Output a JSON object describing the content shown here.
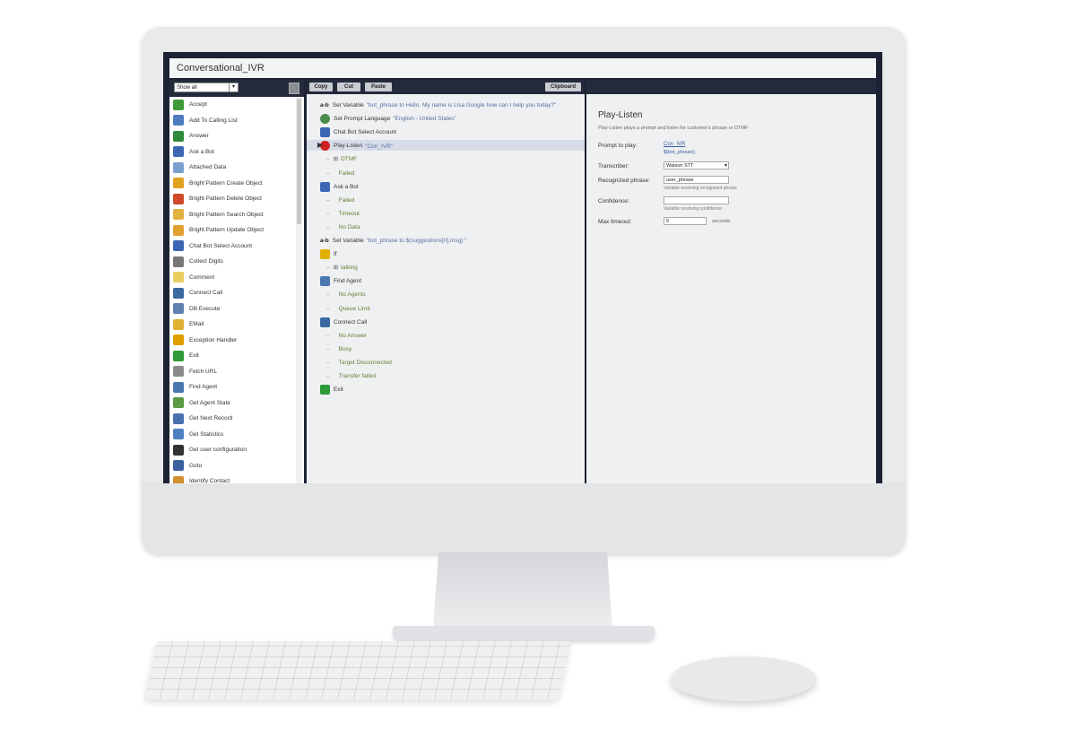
{
  "window": {
    "title": "Conversational_IVR"
  },
  "palette": {
    "filter_value": "Show all",
    "items": [
      {
        "label": "Accept",
        "icon": "accept-icon",
        "color": "#3f9a3a"
      },
      {
        "label": "Add To Calling List",
        "icon": "calling-list-icon",
        "color": "#4d7cc0"
      },
      {
        "label": "Answer",
        "icon": "answer-icon",
        "color": "#2f8a3a"
      },
      {
        "label": "Ask a Bot",
        "icon": "bot-icon",
        "color": "#3d67b5"
      },
      {
        "label": "Attached Data",
        "icon": "attached-data-icon",
        "color": "#7aa0d0"
      },
      {
        "label": "Bright Pattern Create Object",
        "icon": "create-object-icon",
        "color": "#e0a020"
      },
      {
        "label": "Bright Pattern Delete Object",
        "icon": "delete-object-icon",
        "color": "#d04a2a"
      },
      {
        "label": "Bright Pattern Search Object",
        "icon": "search-object-icon",
        "color": "#e0b040"
      },
      {
        "label": "Bright Pattern Update Object",
        "icon": "update-object-icon",
        "color": "#e0a030"
      },
      {
        "label": "Chat Bot Select Account",
        "icon": "bot-account-icon",
        "color": "#3d67b5"
      },
      {
        "label": "Collect Digits",
        "icon": "keypad-icon",
        "color": "#777777"
      },
      {
        "label": "Comment",
        "icon": "comment-icon",
        "color": "#e8cf60"
      },
      {
        "label": "Connect Call",
        "icon": "connect-call-icon",
        "color": "#3a6aa0"
      },
      {
        "label": "DB Execute",
        "icon": "database-icon",
        "color": "#6080b0"
      },
      {
        "label": "EMail",
        "icon": "email-icon",
        "color": "#e0b030"
      },
      {
        "label": "Exception Handler",
        "icon": "warning-icon",
        "color": "#e0a000"
      },
      {
        "label": "Exit",
        "icon": "exit-icon",
        "color": "#2e9a3a"
      },
      {
        "label": "Fetch URL",
        "icon": "fetch-url-icon",
        "color": "#8a8a8a"
      },
      {
        "label": "Find Agent",
        "icon": "find-agent-icon",
        "color": "#4a78b0"
      },
      {
        "label": "Get Agent State",
        "icon": "agent-state-icon",
        "color": "#5a9a40"
      },
      {
        "label": "Get Next Record",
        "icon": "next-record-icon",
        "color": "#4a70b0"
      },
      {
        "label": "Get Statistics",
        "icon": "statistics-icon",
        "color": "#5080c0"
      },
      {
        "label": "Get user configuration",
        "icon": "user-config-icon",
        "color": "#333333"
      },
      {
        "label": "Goto",
        "icon": "goto-icon",
        "color": "#3a60a0"
      },
      {
        "label": "Identify Contact",
        "icon": "identify-contact-icon",
        "color": "#d09030"
      }
    ]
  },
  "toolbar": {
    "copy": "Copy",
    "cut": "Cut",
    "paste": "Paste",
    "clipboard": "Clipboard"
  },
  "script": [
    {
      "type": "step",
      "icon": "set-variable-icon",
      "prefix": "a-b",
      "label": "Set Variable",
      "arg": "\"bot_phrase to Hello. My name is Lisa Google how can I help you today?\""
    },
    {
      "type": "step",
      "icon": "globe-icon",
      "label": "Set Prompt Language",
      "arg": "\"English - United States\""
    },
    {
      "type": "step",
      "icon": "bot-icon",
      "label": "Chat Bot Select Account",
      "arg": ""
    },
    {
      "type": "step",
      "icon": "play-listen-icon",
      "label": "Play-Listen",
      "arg": "\"Con_IVR\"",
      "selected": true
    },
    {
      "type": "branch",
      "label": "DTMF",
      "expand": true
    },
    {
      "type": "branch",
      "label": "Failed"
    },
    {
      "type": "step",
      "icon": "bot-icon",
      "label": "Ask a Bot",
      "arg": ""
    },
    {
      "type": "branch",
      "label": "Failed"
    },
    {
      "type": "branch",
      "label": "Timeout"
    },
    {
      "type": "branch",
      "label": "No Data"
    },
    {
      "type": "step",
      "icon": "set-variable-icon",
      "prefix": "a-b",
      "label": "Set Variable",
      "arg": "\"bot_phrase to $(suggestions[0].msg) \""
    },
    {
      "type": "step",
      "icon": "traffic-light-icon",
      "label": "If",
      "arg": ""
    },
    {
      "type": "branch",
      "label": "talking",
      "expand": true
    },
    {
      "type": "step",
      "icon": "find-agent-icon",
      "label": "Find Agent",
      "arg": ""
    },
    {
      "type": "branch",
      "label": "No Agents"
    },
    {
      "type": "branch",
      "label": "Queue Limit"
    },
    {
      "type": "step",
      "icon": "connect-call-icon",
      "label": "Connect Call",
      "arg": ""
    },
    {
      "type": "branch",
      "label": "No Answer"
    },
    {
      "type": "branch",
      "label": "Busy"
    },
    {
      "type": "branch",
      "label": "Target Disconnected"
    },
    {
      "type": "branch",
      "label": "Transfer failed"
    },
    {
      "type": "step",
      "icon": "exit-icon",
      "label": "Exit",
      "arg": ""
    }
  ],
  "properties": {
    "title": "Play-Listen",
    "description": "Play-Listen plays a prompt and listen for customer's phrase or DTMF",
    "prompt_label": "Prompt to play:",
    "prompt_link": "Con_IVR",
    "prompt_var": "${bot_phrase};",
    "transcriber_label": "Transcriber:",
    "transcriber_value": "Watson STT",
    "recognized_label": "Recognized phrase:",
    "recognized_value": "user_phrase",
    "recognized_hint": "Variable receiving recognized phrase",
    "confidence_label": "Confidence:",
    "confidence_value": "",
    "confidence_hint": "Variable receiving confidence",
    "max_timeout_label": "Max timeout:",
    "max_timeout_value": "5",
    "max_timeout_unit": "seconds"
  }
}
